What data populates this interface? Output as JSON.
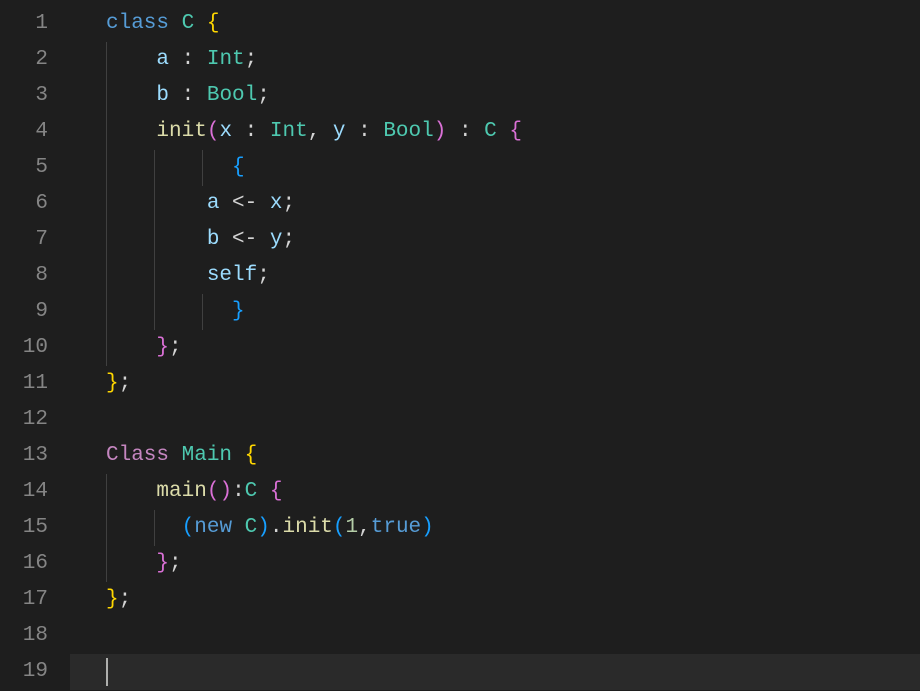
{
  "editor": {
    "line_count": 19,
    "current_line": 19,
    "line_numbers": [
      "1",
      "2",
      "3",
      "4",
      "5",
      "6",
      "7",
      "8",
      "9",
      "10",
      "11",
      "12",
      "13",
      "14",
      "15",
      "16",
      "17",
      "18",
      "19"
    ],
    "code_lines": [
      [
        {
          "cls": "kw",
          "t": "class"
        },
        {
          "cls": "op",
          "t": " "
        },
        {
          "cls": "type",
          "t": "C"
        },
        {
          "cls": "op",
          "t": " "
        },
        {
          "cls": "paren-y",
          "t": "{"
        }
      ],
      [
        {
          "cls": "op",
          "t": "    "
        },
        {
          "cls": "var",
          "t": "a"
        },
        {
          "cls": "op",
          "t": " : "
        },
        {
          "cls": "type",
          "t": "Int"
        },
        {
          "cls": "op",
          "t": ";"
        }
      ],
      [
        {
          "cls": "op",
          "t": "    "
        },
        {
          "cls": "var",
          "t": "b"
        },
        {
          "cls": "op",
          "t": " : "
        },
        {
          "cls": "type",
          "t": "Bool"
        },
        {
          "cls": "op",
          "t": ";"
        }
      ],
      [
        {
          "cls": "op",
          "t": "    "
        },
        {
          "cls": "fn",
          "t": "init"
        },
        {
          "cls": "paren-p",
          "t": "("
        },
        {
          "cls": "var",
          "t": "x"
        },
        {
          "cls": "op",
          "t": " : "
        },
        {
          "cls": "type",
          "t": "Int"
        },
        {
          "cls": "op",
          "t": ", "
        },
        {
          "cls": "var",
          "t": "y"
        },
        {
          "cls": "op",
          "t": " : "
        },
        {
          "cls": "type",
          "t": "Bool"
        },
        {
          "cls": "paren-p",
          "t": ")"
        },
        {
          "cls": "op",
          "t": " : "
        },
        {
          "cls": "type",
          "t": "C"
        },
        {
          "cls": "op",
          "t": " "
        },
        {
          "cls": "paren-p",
          "t": "{"
        }
      ],
      [
        {
          "cls": "op",
          "t": "          "
        },
        {
          "cls": "paren-b",
          "t": "{"
        }
      ],
      [
        {
          "cls": "op",
          "t": "        "
        },
        {
          "cls": "var",
          "t": "a"
        },
        {
          "cls": "op",
          "t": " <- "
        },
        {
          "cls": "var",
          "t": "x"
        },
        {
          "cls": "op",
          "t": ";"
        }
      ],
      [
        {
          "cls": "op",
          "t": "        "
        },
        {
          "cls": "var",
          "t": "b"
        },
        {
          "cls": "op",
          "t": " <- "
        },
        {
          "cls": "var",
          "t": "y"
        },
        {
          "cls": "op",
          "t": ";"
        }
      ],
      [
        {
          "cls": "op",
          "t": "        "
        },
        {
          "cls": "var",
          "t": "self"
        },
        {
          "cls": "op",
          "t": ";"
        }
      ],
      [
        {
          "cls": "op",
          "t": "          "
        },
        {
          "cls": "paren-b",
          "t": "}"
        }
      ],
      [
        {
          "cls": "op",
          "t": "    "
        },
        {
          "cls": "paren-p",
          "t": "}"
        },
        {
          "cls": "op",
          "t": ";"
        }
      ],
      [
        {
          "cls": "paren-y",
          "t": "}"
        },
        {
          "cls": "op",
          "t": ";"
        }
      ],
      [],
      [
        {
          "cls": "ctrl",
          "t": "Class"
        },
        {
          "cls": "op",
          "t": " "
        },
        {
          "cls": "type",
          "t": "Main"
        },
        {
          "cls": "op",
          "t": " "
        },
        {
          "cls": "paren-y",
          "t": "{"
        }
      ],
      [
        {
          "cls": "op",
          "t": "    "
        },
        {
          "cls": "fn",
          "t": "main"
        },
        {
          "cls": "paren-p",
          "t": "()"
        },
        {
          "cls": "op",
          "t": ":"
        },
        {
          "cls": "type",
          "t": "C"
        },
        {
          "cls": "op",
          "t": " "
        },
        {
          "cls": "paren-p",
          "t": "{"
        }
      ],
      [
        {
          "cls": "op",
          "t": "      "
        },
        {
          "cls": "paren-b",
          "t": "("
        },
        {
          "cls": "new",
          "t": "new"
        },
        {
          "cls": "op",
          "t": " "
        },
        {
          "cls": "type",
          "t": "C"
        },
        {
          "cls": "paren-b",
          "t": ")"
        },
        {
          "cls": "op",
          "t": "."
        },
        {
          "cls": "fn",
          "t": "init"
        },
        {
          "cls": "paren-b",
          "t": "("
        },
        {
          "cls": "num",
          "t": "1"
        },
        {
          "cls": "op",
          "t": ","
        },
        {
          "cls": "new",
          "t": "true"
        },
        {
          "cls": "paren-b",
          "t": ")"
        }
      ],
      [
        {
          "cls": "op",
          "t": "    "
        },
        {
          "cls": "paren-p",
          "t": "}"
        },
        {
          "cls": "op",
          "t": ";"
        }
      ],
      [
        {
          "cls": "paren-y",
          "t": "}"
        },
        {
          "cls": "op",
          "t": ";"
        }
      ],
      [],
      []
    ],
    "indent_guides": {
      "1": [],
      "2": [
        0
      ],
      "3": [
        0
      ],
      "4": [
        0
      ],
      "5": [
        0,
        1,
        2
      ],
      "6": [
        0,
        1
      ],
      "7": [
        0,
        1
      ],
      "8": [
        0,
        1
      ],
      "9": [
        0,
        1,
        2
      ],
      "10": [
        0
      ],
      "11": [],
      "12": [],
      "13": [],
      "14": [
        0
      ],
      "15": [
        0,
        1
      ],
      "16": [
        0
      ],
      "17": [],
      "18": [],
      "19": []
    }
  }
}
